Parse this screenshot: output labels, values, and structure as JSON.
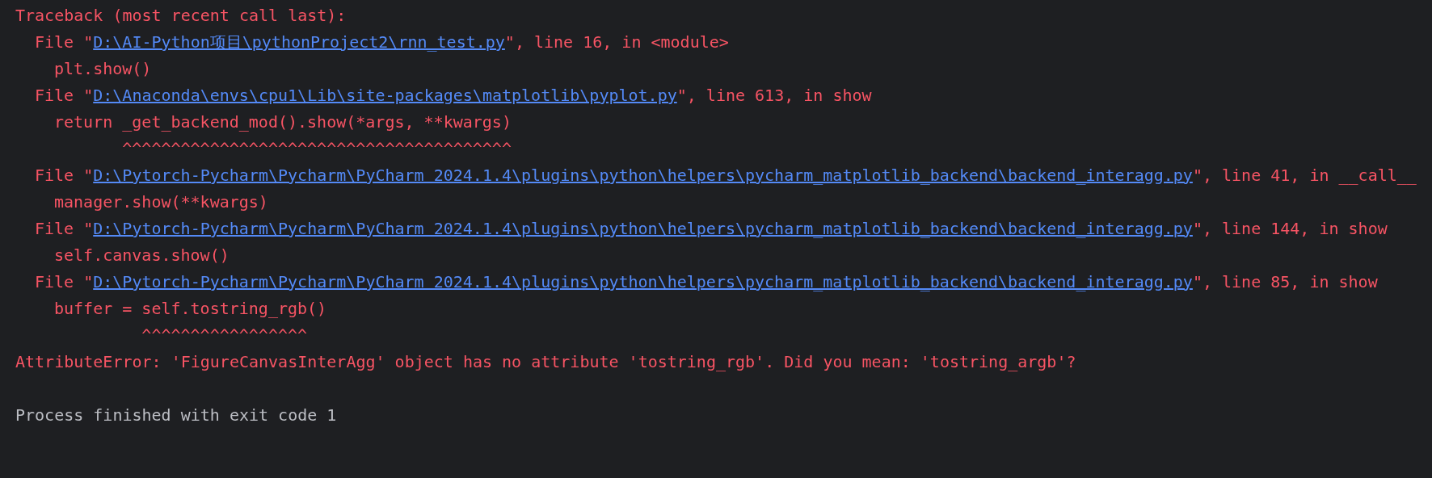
{
  "console": {
    "lines": [
      {
        "kind": "header",
        "text": "Traceback (most recent call last):"
      },
      {
        "kind": "frame",
        "prefix": "File \"",
        "path": "D:\\AI-Python项目\\pythonProject2\\rnn_test.py",
        "suffix": "\", line 16, in <module>"
      },
      {
        "kind": "code",
        "text": "plt.show()"
      },
      {
        "kind": "frame",
        "prefix": "File \"",
        "path": "D:\\Anaconda\\envs\\cpu1\\Lib\\site-packages\\matplotlib\\pyplot.py",
        "suffix": "\", line 613, in show"
      },
      {
        "kind": "code",
        "text": "return _get_backend_mod().show(*args, **kwargs)"
      },
      {
        "kind": "carets",
        "text": "       ^^^^^^^^^^^^^^^^^^^^^^^^^^^^^^^^^^^^^^^^"
      },
      {
        "kind": "frame",
        "prefix": "File \"",
        "path": "D:\\Pytorch-Pycharm\\Pycharm\\PyCharm 2024.1.4\\plugins\\python\\helpers\\pycharm_matplotlib_backend\\backend_interagg.py",
        "suffix": "\", line 41, in __call__"
      },
      {
        "kind": "code",
        "text": "manager.show(**kwargs)"
      },
      {
        "kind": "frame",
        "prefix": "File \"",
        "path": "D:\\Pytorch-Pycharm\\Pycharm\\PyCharm 2024.1.4\\plugins\\python\\helpers\\pycharm_matplotlib_backend\\backend_interagg.py",
        "suffix": "\", line 144, in show"
      },
      {
        "kind": "code",
        "text": "self.canvas.show()"
      },
      {
        "kind": "frame",
        "prefix": "File \"",
        "path": "D:\\Pytorch-Pycharm\\Pycharm\\PyCharm 2024.1.4\\plugins\\python\\helpers\\pycharm_matplotlib_backend\\backend_interagg.py",
        "suffix": "\", line 85, in show"
      },
      {
        "kind": "code",
        "text": "buffer = self.tostring_rgb()"
      },
      {
        "kind": "carets",
        "text": "         ^^^^^^^^^^^^^^^^^"
      },
      {
        "kind": "error",
        "text": "AttributeError: 'FigureCanvasInterAgg' object has no attribute 'tostring_rgb'. Did you mean: 'tostring_argb'?"
      },
      {
        "kind": "blank"
      },
      {
        "kind": "process",
        "text": "Process finished with exit code 1"
      }
    ]
  }
}
